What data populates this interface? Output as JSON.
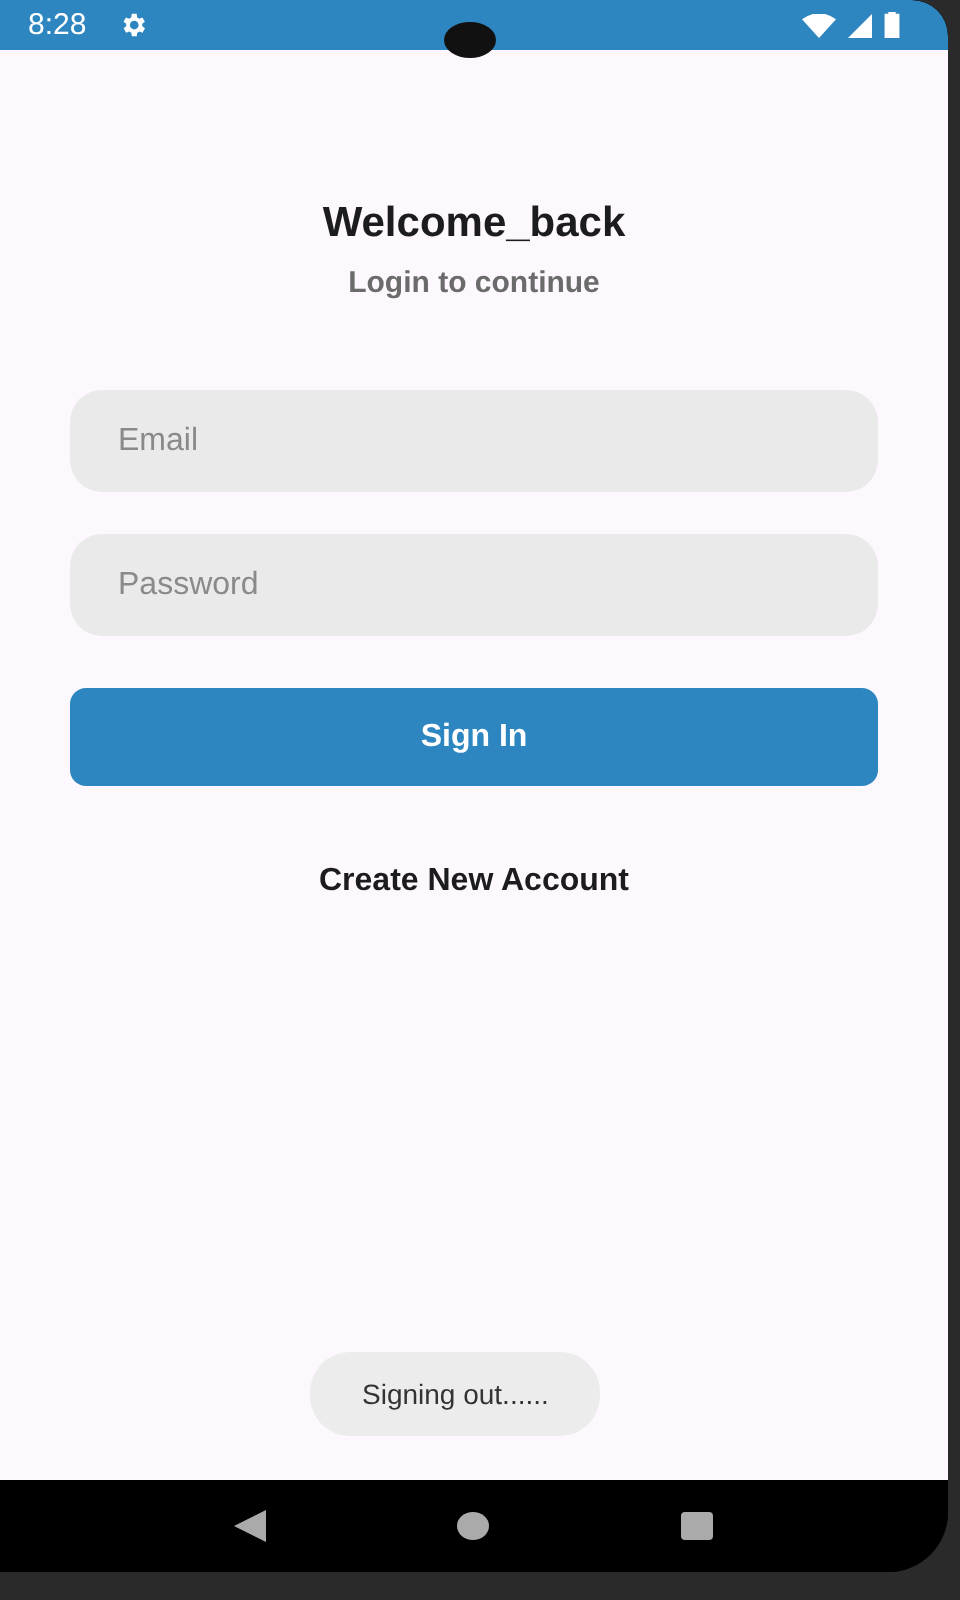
{
  "status_bar": {
    "time": "8:28"
  },
  "title": "Welcome_back",
  "subtitle": "Login to continue",
  "fields": [
    {
      "placeholder": "Email"
    },
    {
      "placeholder": "Password"
    }
  ],
  "sign_in_button": "Sign In",
  "create_account_link": "Create New Account",
  "toast": "Signing out......"
}
